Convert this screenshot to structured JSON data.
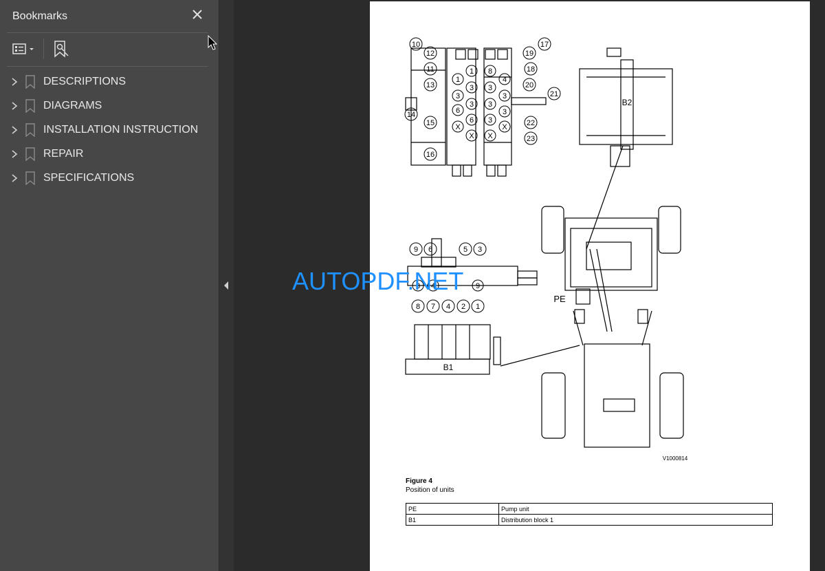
{
  "sidebar": {
    "title": "Bookmarks",
    "items": [
      {
        "label": "DESCRIPTIONS"
      },
      {
        "label": "DIAGRAMS"
      },
      {
        "label": "INSTALLATION INSTRUCTION"
      },
      {
        "label": "REPAIR"
      },
      {
        "label": "SPECIFICATIONS"
      }
    ]
  },
  "document": {
    "diagram_labels": {
      "top_left_numbers": [
        "10",
        "12",
        "11",
        "13",
        "14",
        "15",
        "16",
        "1",
        "1",
        "3",
        "3",
        "6",
        "6",
        "3",
        "X",
        "X"
      ],
      "top_mid_numbers": [
        "17",
        "19",
        "18",
        "20",
        "21",
        "22",
        "23",
        "8",
        "4",
        "3",
        "3",
        "3",
        "3",
        "3",
        "X",
        "X"
      ],
      "b2": "B2",
      "b1": "B1",
      "pe": "PE",
      "block_top_numbers": [
        "9",
        "6",
        "5",
        "3"
      ],
      "block_bottom_numbers": [
        "8",
        "7",
        "4",
        "2",
        "1"
      ],
      "block_inner_numbers": [
        "3",
        "4",
        "9"
      ],
      "image_code": "V1000814"
    },
    "figure_number": "Figure 4",
    "figure_caption": "Position of units",
    "legend": [
      {
        "code": "PE",
        "desc": "Pump unit"
      },
      {
        "code": "B1",
        "desc": "Distribution block 1"
      }
    ]
  },
  "watermark": "AUTOPDF.NET",
  "colors": {
    "sidebar_bg": "#474747",
    "viewer_bg": "#2b2b2b",
    "watermark": "#1e90ff"
  }
}
